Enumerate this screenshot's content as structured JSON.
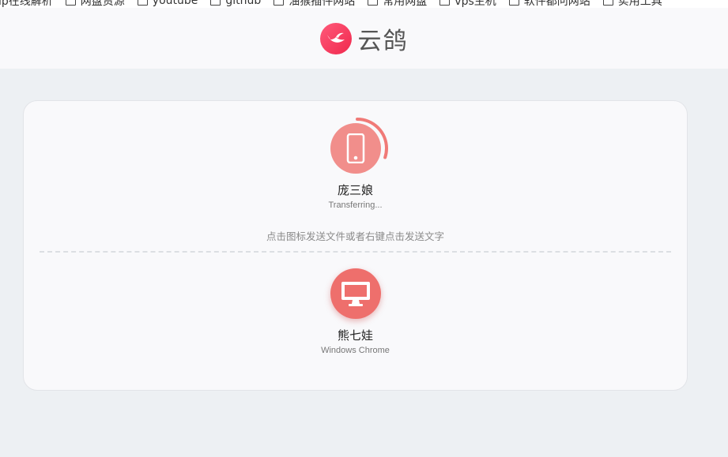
{
  "bookmarks": [
    {
      "label": "ip在线解析"
    },
    {
      "label": "网盘资源"
    },
    {
      "label": "youtube"
    },
    {
      "label": "github"
    },
    {
      "label": "油猴插件网站"
    },
    {
      "label": "常用网盘"
    },
    {
      "label": "vps主机"
    },
    {
      "label": "软件都问网站"
    },
    {
      "label": "实用工具"
    }
  ],
  "header": {
    "app_name": "云鸽",
    "brand_color": "#f0284d"
  },
  "devices": [
    {
      "name": "庞三娘",
      "status": "Transferring...",
      "icon": "phone-icon",
      "color": "#f18e8b",
      "progress_pct": 30
    },
    {
      "name": "熊七娃",
      "status": "Windows Chrome",
      "icon": "desktop-icon",
      "color": "#ee6f6c"
    }
  ],
  "hint_text": "点击图标发送文件或者右键点击发送文字"
}
